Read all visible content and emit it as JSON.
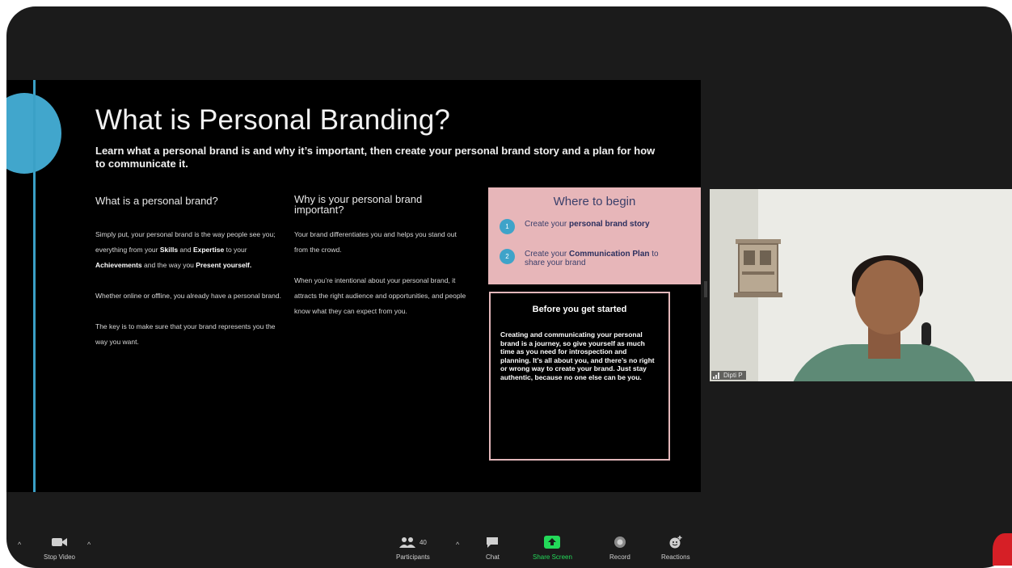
{
  "slide": {
    "title": "What is Personal Branding?",
    "subtitle": "Learn what a personal brand is and why it’s important, then create your personal brand story and a plan for how to communicate it.",
    "col1": {
      "heading": "What is a personal brand?",
      "p1_a": "Simply put, your personal brand is the way people see you; everything from your ",
      "p1_b1": "Skills",
      "p1_c": " and ",
      "p1_b2": "Expertise",
      "p1_d": " to your ",
      "p1_b3": "Achievements",
      "p1_e": " and the way you ",
      "p1_b4": "Present yourself.",
      "p2": "Whether online or offline, you already have a personal brand.",
      "p3": "The key is to make sure that your brand represents you the way you want."
    },
    "col2": {
      "heading": "Why is your personal brand important?",
      "p1": "Your brand differentiates you and helps you stand out from the crowd.",
      "p2": "When you’re intentional about your personal brand, it attracts the right audience and opportunities, and people know what they can expect from you."
    },
    "where": {
      "heading": "Where to begin",
      "step1_num": "1",
      "step1_pre": "Create your ",
      "step1_bold": "personal brand story",
      "step2_num": "2",
      "step2_pre": "Create your ",
      "step2_bold": "Communication Plan",
      "step2_post": " to  share your brand"
    },
    "before": {
      "heading": "Before you get started",
      "body": "Creating and communicating your personal brand is a journey, so give yourself as much time as you need for introspection and planning. It’s all about you, and there’s no right or wrong way to create your brand. Just stay authentic, because no one else can be you."
    }
  },
  "participant": {
    "name": "Dipti P"
  },
  "toolbar": {
    "stop_video": "Stop Video",
    "participants": "Participants",
    "participants_count": "40",
    "chat": "Chat",
    "share_screen": "Share Screen",
    "record": "Record",
    "reactions": "Reactions"
  },
  "colors": {
    "accent_blue": "#41a6cc",
    "pink_box": "#e7b6b9",
    "share_green": "#23d959"
  }
}
